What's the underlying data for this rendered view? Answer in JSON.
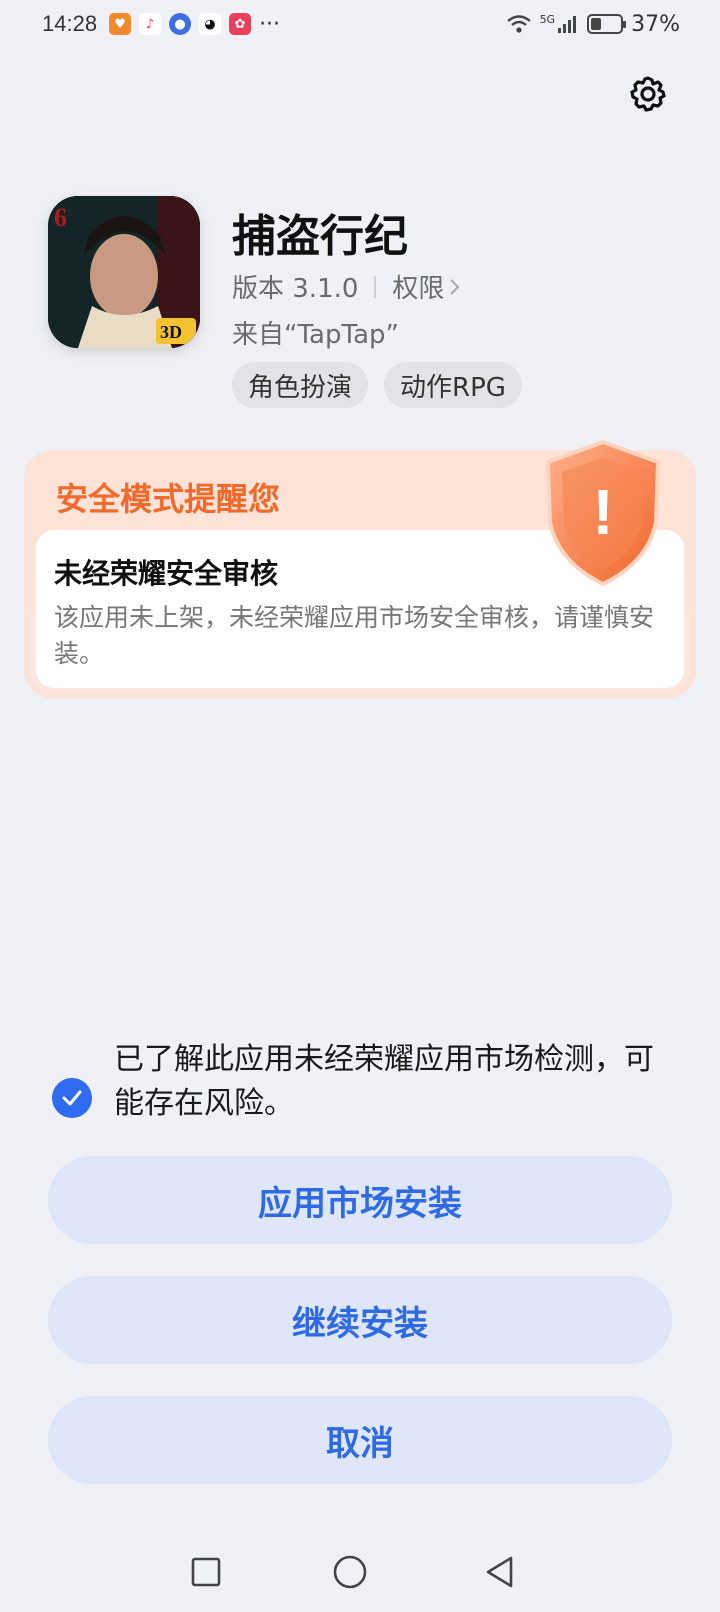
{
  "status_bar": {
    "time": "14:28",
    "more": "···",
    "network": "5G",
    "battery_percent": "37%",
    "battery_level": 0.37
  },
  "settings": {
    "icon": "gear-icon"
  },
  "app": {
    "name": "捕盗行纪",
    "version": "版本 3.1.0",
    "permissions": "权限",
    "source": "来自“TapTap”",
    "icon_badge_number": "6",
    "icon_badge_3d": "3D",
    "tags": [
      "角色扮演",
      "动作RPG"
    ]
  },
  "warning": {
    "title": "安全模式提醒您",
    "subtitle": "未经荣耀安全审核",
    "description": "该应用未上架，未经荣耀应用市场安全审核，请谨慎安装。",
    "shield_mark": "!"
  },
  "consent": {
    "checked": true,
    "text": "已了解此应用未经荣耀应用市场检测，可能存在风险。"
  },
  "buttons": {
    "store_install": "应用市场安装",
    "continue_install": "继续安装",
    "cancel": "取消"
  },
  "colors": {
    "accent": "#2d6ae3",
    "warning": "#f06a2c",
    "button_bg": "#dfe6f7",
    "background": "#eff1f6"
  }
}
